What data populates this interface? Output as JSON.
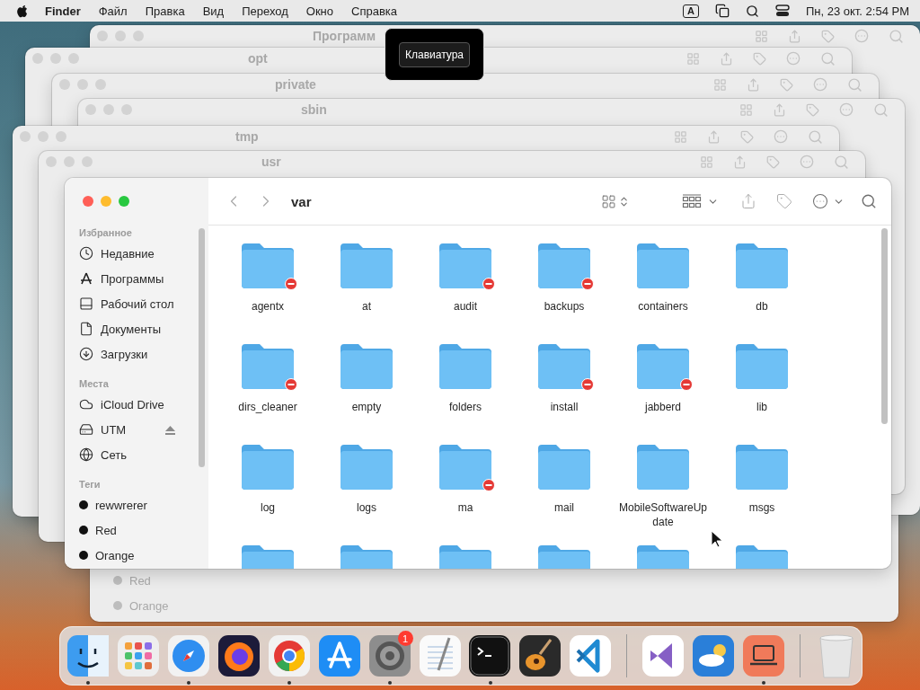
{
  "menu_bar": {
    "app": "Finder",
    "menus": [
      "Файл",
      "Правка",
      "Вид",
      "Переход",
      "Окно",
      "Справка"
    ],
    "input_source": "A",
    "clock": "Пн, 23 окт.  2:54 PM"
  },
  "hud": {
    "label": "Клавиатура"
  },
  "background_windows": [
    {
      "tags": [
        "Red",
        "Orange"
      ]
    },
    {
      "title": "Программ"
    },
    {
      "title": "opt"
    },
    {
      "title": "private"
    },
    {
      "title": "sbin"
    },
    {
      "title": "tmp"
    },
    {
      "title": "usr"
    }
  ],
  "window": {
    "path": "var",
    "sidebar": [
      {
        "heading": "Избранное",
        "items": [
          {
            "label": "Недавние",
            "kind": "clock"
          },
          {
            "label": "Программы",
            "kind": "apps"
          },
          {
            "label": "Рабочий стол",
            "kind": "desktop"
          },
          {
            "label": "Документы",
            "kind": "document"
          },
          {
            "label": "Загрузки",
            "kind": "download"
          }
        ]
      },
      {
        "heading": "Места",
        "items": [
          {
            "label": "iCloud Drive",
            "kind": "cloud"
          },
          {
            "label": "UTM",
            "kind": "drive",
            "ejectable": true
          },
          {
            "label": "Сеть",
            "kind": "network"
          }
        ]
      },
      {
        "heading": "Теги",
        "items": [
          {
            "label": "rewwrerer",
            "kind": "tag",
            "color": "#111111"
          },
          {
            "label": "Red",
            "kind": "tag",
            "color": "#111111"
          },
          {
            "label": "Orange",
            "kind": "tag",
            "color": "#111111"
          }
        ]
      }
    ],
    "folders": [
      {
        "name": "agentx",
        "restricted": true
      },
      {
        "name": "at",
        "restricted": false
      },
      {
        "name": "audit",
        "restricted": true
      },
      {
        "name": "backups",
        "restricted": true
      },
      {
        "name": "containers",
        "restricted": false
      },
      {
        "name": "db",
        "restricted": false
      },
      {
        "name": "dirs_cleaner",
        "restricted": true
      },
      {
        "name": "empty",
        "restricted": false
      },
      {
        "name": "folders",
        "restricted": false
      },
      {
        "name": "install",
        "restricted": true
      },
      {
        "name": "jabberd",
        "restricted": true
      },
      {
        "name": "lib",
        "restricted": false
      },
      {
        "name": "log",
        "restricted": false
      },
      {
        "name": "logs",
        "restricted": false
      },
      {
        "name": "ma",
        "restricted": true
      },
      {
        "name": "mail",
        "restricted": false
      },
      {
        "name": "MobileSoftwareUpdate",
        "restricted": false
      },
      {
        "name": "msgs",
        "restricted": false
      },
      {
        "restricted": false
      },
      {
        "restricted": false
      },
      {
        "restricted": false
      },
      {
        "restricted": false
      },
      {
        "restricted": false
      },
      {
        "restricted": false
      }
    ]
  },
  "dock": [
    [
      {
        "kind": "finder",
        "running": true
      },
      {
        "kind": "launchpad",
        "running": false
      },
      {
        "kind": "safari",
        "running": true
      },
      {
        "kind": "firefox",
        "running": false
      },
      {
        "kind": "chrome",
        "running": true
      },
      {
        "kind": "appstore",
        "running": false
      },
      {
        "kind": "settings",
        "running": true,
        "badge": "1"
      },
      {
        "kind": "textedit",
        "running": false
      },
      {
        "kind": "terminal",
        "running": true
      },
      {
        "kind": "garageband",
        "running": false
      },
      {
        "kind": "vscode",
        "running": false
      }
    ],
    [
      {
        "kind": "visualstudio",
        "running": false
      },
      {
        "kind": "weather",
        "running": false
      },
      {
        "kind": "screen",
        "running": true
      }
    ],
    [
      {
        "kind": "trash",
        "running": false
      }
    ]
  ]
}
